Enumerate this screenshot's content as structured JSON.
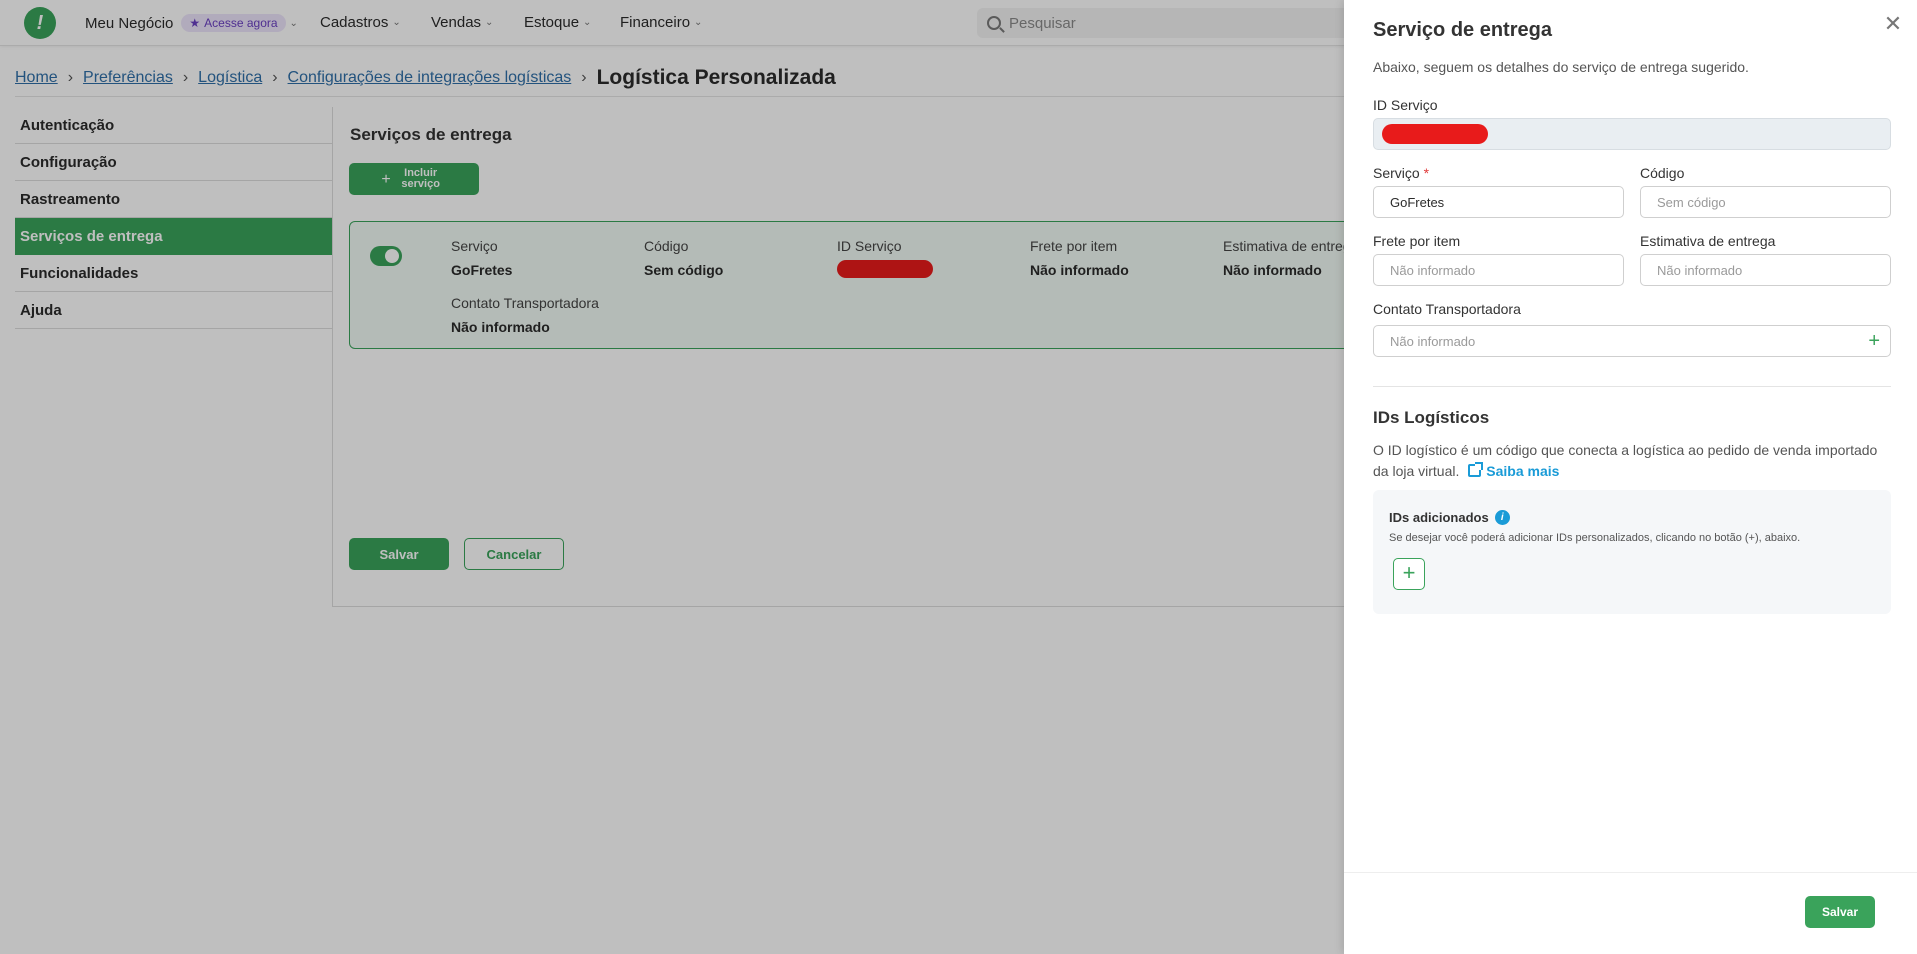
{
  "topbar": {
    "logo_glyph": "!",
    "business": "Meu Negócio",
    "promo": "Acesse agora",
    "menus": [
      "Cadastros",
      "Vendas",
      "Estoque",
      "Financeiro"
    ],
    "search_placeholder": "Pesquisar"
  },
  "breadcrumb": {
    "items": [
      "Home",
      "Preferências",
      "Logística",
      "Configurações de integrações logísticas"
    ],
    "current": "Logística Personalizada"
  },
  "sidebar": {
    "items": [
      "Autenticação",
      "Configuração",
      "Rastreamento",
      "Serviços de entrega",
      "Funcionalidades",
      "Ajuda"
    ],
    "active": "Serviços de entrega"
  },
  "main": {
    "section_title": "Serviços de entrega",
    "include_button": "Incluir serviço",
    "card": {
      "enabled": true,
      "fields": [
        {
          "label": "Serviço",
          "value": "GoFretes"
        },
        {
          "label": "Código",
          "value": "Sem código"
        },
        {
          "label": "ID Serviço",
          "value": ""
        },
        {
          "label": "Frete por item",
          "value": "Não informado"
        },
        {
          "label": "Estimativa de entrega",
          "value": "Não informado"
        },
        {
          "label": "Contato Transportadora",
          "value": "Não informado"
        }
      ]
    },
    "save_button": "Salvar",
    "cancel_button": "Cancelar"
  },
  "drawer": {
    "title": "Serviço de entrega",
    "close_glyph": "✕",
    "subtitle": "Abaixo, seguem os detalhes do serviço de entrega sugerido.",
    "id_servico_label": "ID Serviço",
    "servico_label": "Serviço",
    "required_mark": "*",
    "servico_value": "GoFretes",
    "codigo_label": "Código",
    "codigo_placeholder": "Sem código",
    "frete_label": "Frete por item",
    "frete_placeholder": "Não informado",
    "estimativa_label": "Estimativa de entrega",
    "estimativa_placeholder": "Não informado",
    "contato_label": "Contato Transportadora",
    "contato_placeholder": "Não informado",
    "ids_title": "IDs Logísticos",
    "ids_description": "O ID logístico é um código que conecta a logística ao pedido de venda importado da loja virtual.",
    "saiba_mais": "Saiba mais",
    "ids_box_title": "IDs adicionados",
    "ids_box_text": "Se desejar você poderá adicionar IDs personalizados, clicando no botão (+), abaixo.",
    "save_button": "Salvar"
  },
  "colors": {
    "brand_green": "#3aa35b",
    "link_blue": "#1a9bd7",
    "redaction": "#e81b1b"
  }
}
